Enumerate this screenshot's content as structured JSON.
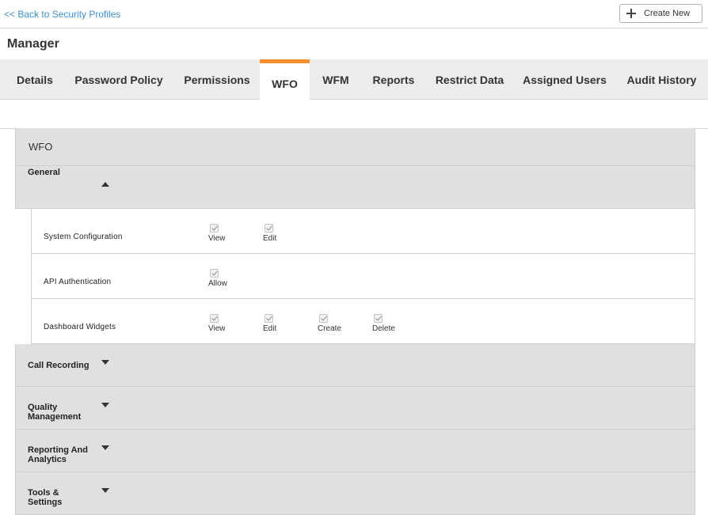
{
  "nav": {
    "back_link": "<< Back to Security Profiles",
    "create_new": "Create New"
  },
  "page_title": "Manager",
  "tabs": [
    {
      "label": "Details",
      "active": false
    },
    {
      "label": "Password Policy",
      "active": false
    },
    {
      "label": "Permissions",
      "active": false
    },
    {
      "label": "WFO",
      "active": true
    },
    {
      "label": "WFM",
      "active": false
    },
    {
      "label": "Reports",
      "active": false
    },
    {
      "label": "Restrict Data",
      "active": false
    },
    {
      "label": "Assigned Users",
      "active": false
    },
    {
      "label": "Audit History",
      "active": false
    }
  ],
  "panel": {
    "header": "WFO",
    "general": {
      "label": "General",
      "expanded": true,
      "rows": [
        {
          "name": "System Configuration",
          "options": [
            {
              "label": "View",
              "checked": true
            },
            {
              "label": "Edit",
              "checked": true
            }
          ]
        },
        {
          "name": "API Authentication",
          "options": [
            {
              "label": "Allow",
              "checked": true
            }
          ]
        },
        {
          "name": "Dashboard Widgets",
          "options": [
            {
              "label": "View",
              "checked": true
            },
            {
              "label": "Edit",
              "checked": true
            },
            {
              "label": "Create",
              "checked": true
            },
            {
              "label": "Delete",
              "checked": true
            }
          ]
        }
      ]
    },
    "collapsed_sections": [
      {
        "line1": "Call Recording",
        "line2": ""
      },
      {
        "line1": "Quality",
        "line2": "Management"
      },
      {
        "line1": "Reporting And",
        "line2": "Analytics"
      },
      {
        "line1": "Tools &",
        "line2": "Settings"
      }
    ]
  },
  "colors": {
    "accent": "#f58e2f",
    "link": "#3d8fd1",
    "section_bg": "#e0e0e0",
    "tabbar_bg": "#ececec"
  }
}
